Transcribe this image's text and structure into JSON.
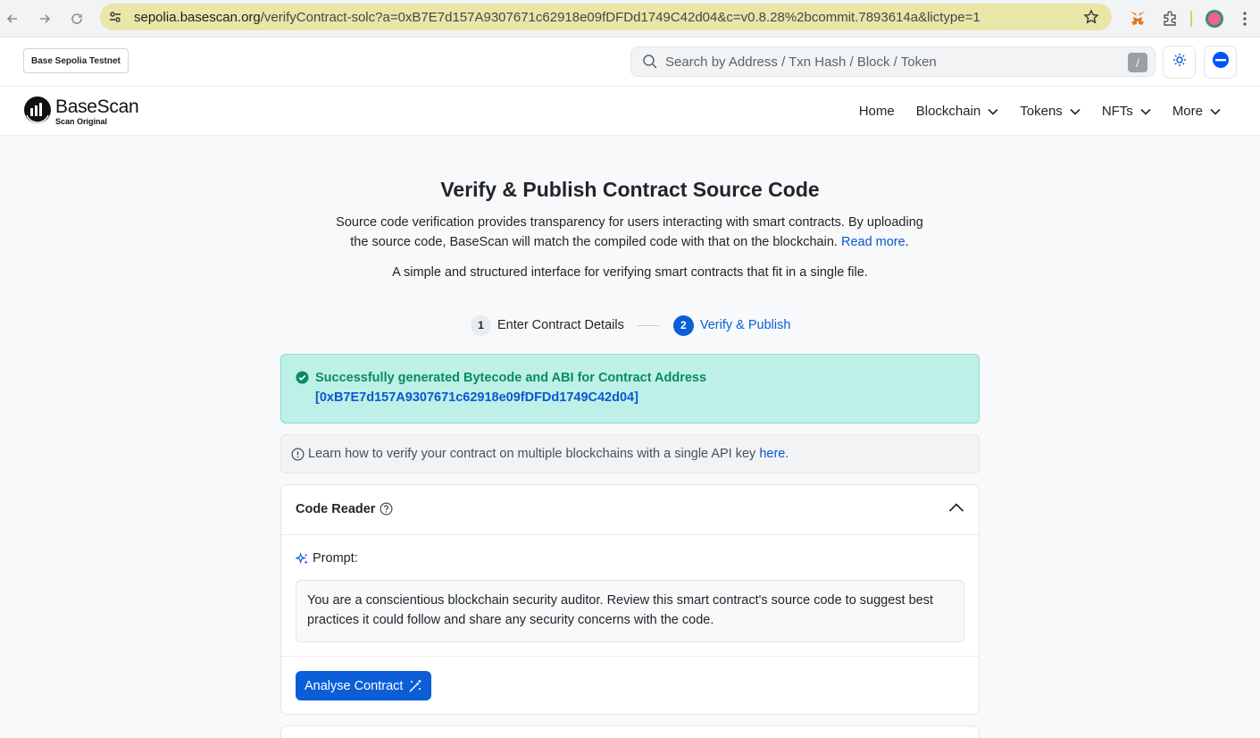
{
  "browser": {
    "url_host": "sepolia.basescan.org",
    "url_path": "/verifyContract-solc?a=0xB7E7d157A9307671c62918e09fDFDd1749C42d04&c=v0.8.28%2bcommit.7893614a&lictype=1"
  },
  "header": {
    "network_badge": "Base Sepolia Testnet",
    "search_placeholder": "Search by Address / Txn Hash / Block / Token",
    "search_shortcut": "/"
  },
  "brand": {
    "name": "BaseScan",
    "tagline": "Scan Original"
  },
  "nav": {
    "items": [
      {
        "label": "Home",
        "dropdown": false
      },
      {
        "label": "Blockchain",
        "dropdown": true
      },
      {
        "label": "Tokens",
        "dropdown": true
      },
      {
        "label": "NFTs",
        "dropdown": true
      },
      {
        "label": "More",
        "dropdown": true
      }
    ]
  },
  "page": {
    "title": "Verify & Publish Contract Source Code",
    "description": "Source code verification provides transparency for users interacting with smart contracts. By uploading the source code, BaseScan will match the compiled code with that on the blockchain.",
    "read_more": "Read more",
    "subtitle": "A simple and structured interface for verifying smart contracts that fit in a single file."
  },
  "steps": [
    {
      "number": "1",
      "label": "Enter Contract Details",
      "active": false
    },
    {
      "number": "2",
      "label": "Verify & Publish",
      "active": true
    }
  ],
  "alert": {
    "message": "Successfully generated Bytecode and ABI for Contract Address",
    "address": "[0xB7E7d157A9307671c62918e09fDFDd1749C42d04]"
  },
  "notice": {
    "text": "Learn how to verify your contract on multiple blockchains with a single API key",
    "link": "here",
    "suffix": "."
  },
  "code_reader": {
    "title": "Code Reader",
    "prompt_label": "Prompt:",
    "prompt_text": "You are a conscientious blockchain security auditor. Review this smart contract's source code to suggest best practices it could follow and share any security concerns with the code.",
    "button": "Analyse Contract"
  },
  "colors": {
    "primary": "#0b5ed7",
    "success_bg": "#bdf1e7",
    "success_text": "#0a8a63"
  }
}
